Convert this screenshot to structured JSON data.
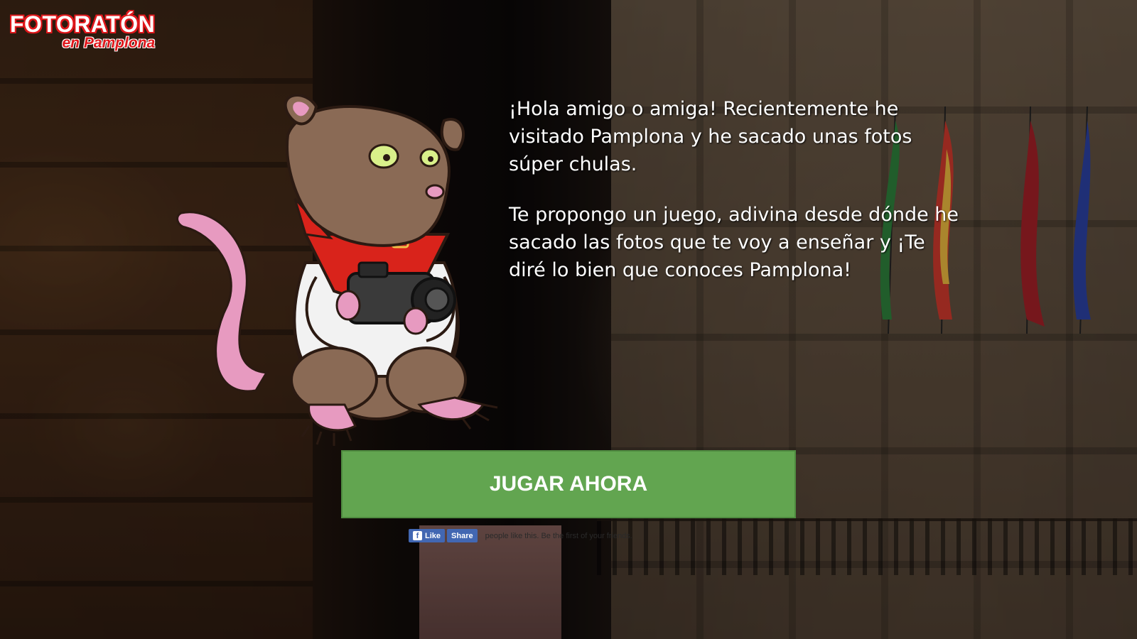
{
  "logo": {
    "title": "FOTORATÓN",
    "subtitle": "en Pamplona"
  },
  "intro": {
    "paragraph1": "¡Hola amigo o amiga! Recientemente he visitado Pamplona y he sacado unas fotos súper chulas.",
    "paragraph2": "Te propongo un juego, adivina desde dónde he sacado las fotos que te voy a enseñar y ¡Te diré lo bien que conoces Pamplona!"
  },
  "play_button": {
    "label": "JUGAR AHORA"
  },
  "facebook": {
    "like_label": "Like",
    "share_label": "Share",
    "social_text": "people like this. Be the first of your friends."
  },
  "colors": {
    "logo_red": "#e0171b",
    "play_green": "#62a550",
    "facebook_blue": "#4267b2",
    "text": "#ffffff"
  },
  "icons": [
    "facebook-icon"
  ]
}
